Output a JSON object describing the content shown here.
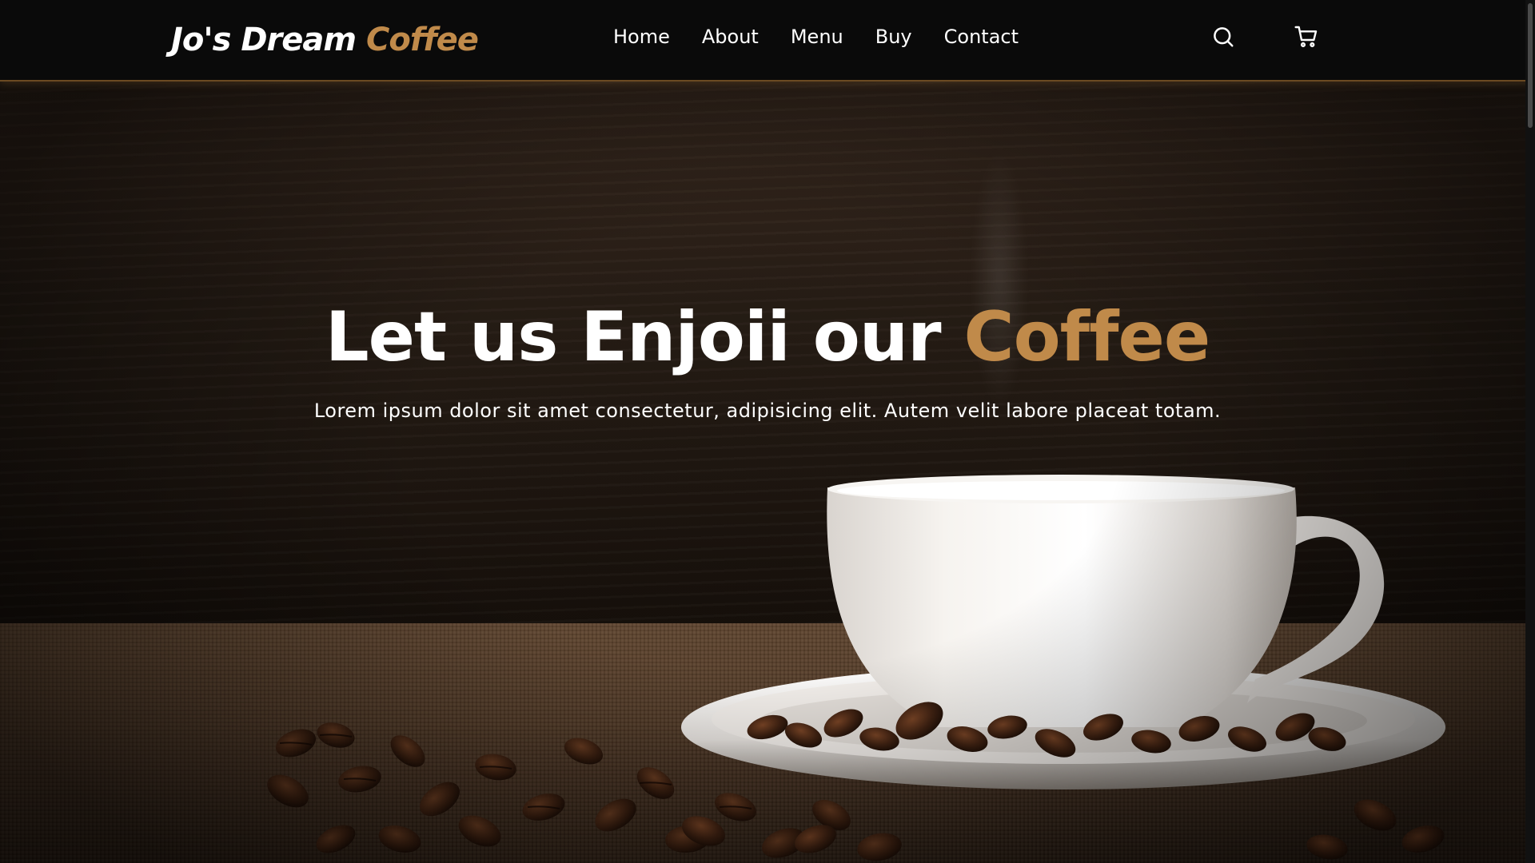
{
  "brand": {
    "name_main": "Jo's Dream",
    "name_accent": "Coffee",
    "accent_color": "#c08a4a"
  },
  "nav": {
    "items": [
      {
        "label": "Home"
      },
      {
        "label": "About"
      },
      {
        "label": "Menu"
      },
      {
        "label": "Buy"
      },
      {
        "label": "Contact"
      }
    ]
  },
  "header_icons": {
    "search": "search-icon",
    "cart": "cart-icon"
  },
  "hero": {
    "title_main": "Let us Enjoii our ",
    "title_accent": "Coffee",
    "subtitle": "Lorem ipsum dolor sit amet consectetur, adipisicing elit. Autem velit labore placeat totam."
  },
  "colors": {
    "header_bg": "#0a0a0a",
    "text": "#ffffff",
    "accent": "#c08a4a"
  }
}
